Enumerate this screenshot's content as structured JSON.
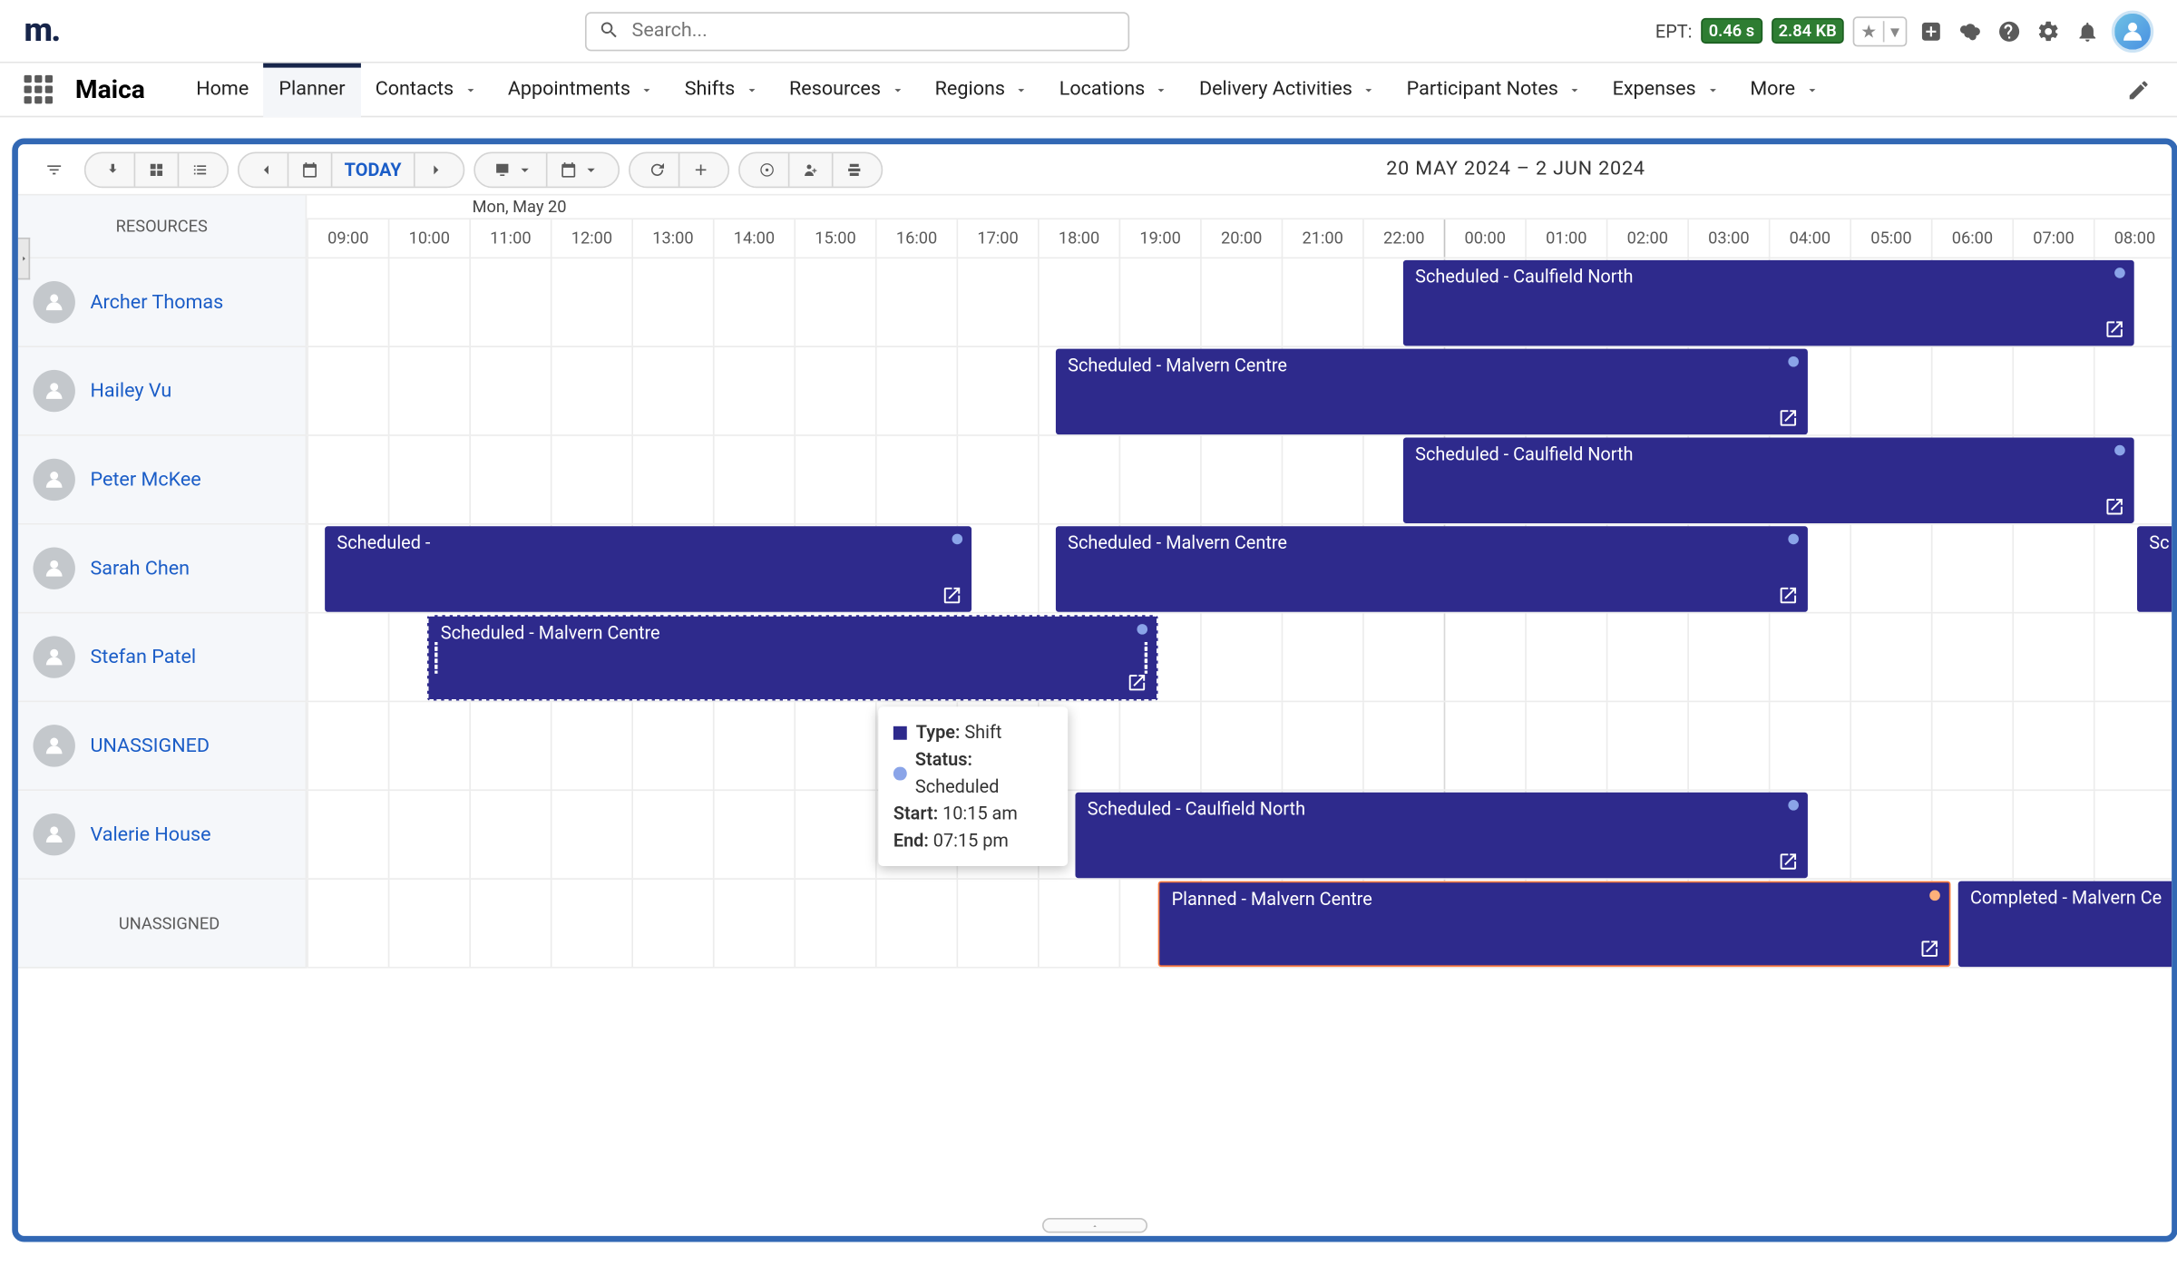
{
  "top": {
    "ept_label": "EPT:",
    "ept_time": "0.46 s",
    "ept_size": "2.84 KB",
    "search_placeholder": "Search..."
  },
  "brand": "Maica",
  "nav": [
    {
      "label": "Home",
      "dd": false
    },
    {
      "label": "Planner",
      "dd": false,
      "active": true
    },
    {
      "label": "Contacts",
      "dd": true
    },
    {
      "label": "Appointments",
      "dd": true
    },
    {
      "label": "Shifts",
      "dd": true
    },
    {
      "label": "Resources",
      "dd": true
    },
    {
      "label": "Regions",
      "dd": true
    },
    {
      "label": "Locations",
      "dd": true
    },
    {
      "label": "Delivery Activities",
      "dd": true
    },
    {
      "label": "Participant Notes",
      "dd": true
    },
    {
      "label": "Expenses",
      "dd": true
    },
    {
      "label": "More",
      "dd": true
    }
  ],
  "today": "TODAY",
  "daterange": "20 MAY 2024 – 2 JUN 2024",
  "resources_header": "RESOURCES",
  "date_header": "Mon, May 20",
  "hours": [
    "09:00",
    "10:00",
    "11:00",
    "12:00",
    "13:00",
    "14:00",
    "15:00",
    "16:00",
    "17:00",
    "18:00",
    "19:00",
    "20:00",
    "21:00",
    "22:00",
    "00:00",
    "01:00",
    "02:00",
    "03:00",
    "04:00",
    "05:00",
    "06:00",
    "07:00",
    "08:00"
  ],
  "resources": [
    {
      "name": "Archer Thomas"
    },
    {
      "name": "Hailey Vu"
    },
    {
      "name": "Peter McKee"
    },
    {
      "name": "Sarah Chen"
    },
    {
      "name": "Stefan Patel"
    },
    {
      "name": "UNASSIGNED"
    },
    {
      "name": "Valerie House"
    }
  ],
  "group_row": "UNASSIGNED",
  "events": {
    "e1": "Scheduled - Caulfield North",
    "e2": "Scheduled - Malvern Centre",
    "e3": "Scheduled - Caulfield North",
    "e4a": "Scheduled -",
    "e4b": "Scheduled - Malvern Centre",
    "e4c": "Sc",
    "e5": "Scheduled - Malvern Centre",
    "e7": "Scheduled - Caulfield North",
    "e8a": "Planned - Malvern Centre",
    "e8b": "Completed - Malvern Ce"
  },
  "tooltip": {
    "type_lbl": "Type:",
    "type_val": "Shift",
    "status_lbl": "Status:",
    "status_val": "Scheduled",
    "start_lbl": "Start:",
    "start_val": "10:15 am",
    "end_lbl": "End:",
    "end_val": "07:15 pm"
  }
}
